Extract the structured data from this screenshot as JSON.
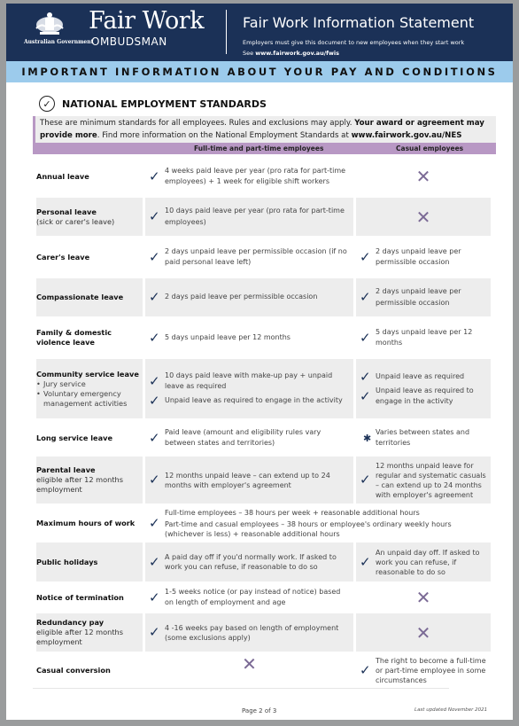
{
  "header": {
    "government": "Australian Government",
    "brand_line1": "Fair Work",
    "brand_line2": "OMBUDSMAN",
    "title": "Fair Work Information Statement",
    "subtitle": "Employers must give this document to new employees when they start work",
    "see_prefix": "See ",
    "see_link": "www.fairwork.gov.au/fwis"
  },
  "banner": "IMPORTANT INFORMATION ABOUT YOUR PAY AND CONDITIONS",
  "section": {
    "icon": "check-circle-icon",
    "title": "NATIONAL EMPLOYMENT STANDARDS",
    "intro_part1": "These are minimum standards for all employees. Rules and exclusions may apply. ",
    "intro_bold": "Your award or agreement may provide more",
    "intro_part2": ". Find more information on the National Employment Standards at ",
    "intro_link": "www.fairwork.gov.au/NES"
  },
  "columns": {
    "fulltime": "Full-time and part-time employees",
    "casual": "Casual employees"
  },
  "rows": [
    {
      "label": "Annual leave",
      "ft": "4 weeks paid leave per year (pro rata for part-time employees) + 1 week for eligible shift workers",
      "casual_mark": "cross"
    },
    {
      "label": "Personal leave",
      "sub": "(sick or carer's leave)",
      "ft": "10 days paid leave per year (pro rata for part-time employees)",
      "casual_mark": "cross"
    },
    {
      "label": "Carer's leave",
      "ft": "2 days unpaid leave per permissible occasion (if no paid personal leave left)",
      "casual": "2 days unpaid leave per permissible occasion"
    },
    {
      "label": "Compassionate leave",
      "ft": "2 days paid leave per permissible occasion",
      "casual": "2 days unpaid leave per permissible occasion"
    },
    {
      "label": "Family & domestic violence leave",
      "ft": "5 days unpaid leave per 12 months",
      "casual": "5 days unpaid leave per 12 months"
    },
    {
      "label": "Community service leave",
      "bullets": [
        "Jury service",
        "Voluntary emergency management activities"
      ],
      "ft_items": [
        "10 days paid leave with make-up pay + unpaid leave as required",
        "Unpaid leave as required to engage in the activity"
      ],
      "casual_items": [
        "Unpaid leave as required",
        "Unpaid leave as required to engage in the activity"
      ]
    },
    {
      "label": "Long service leave",
      "ft": "Paid leave (amount and eligibility rules vary between states and territories)",
      "casual": "Varies between states and territories",
      "casual_mark": "asterisk"
    },
    {
      "label": "Parental leave",
      "sub": "eligible after 12 months employment",
      "ft": "12 months unpaid leave – can extend up to 24 months with employer's agreement",
      "casual": "12 months unpaid leave for regular and systematic casuals – can extend up to 24 months with employer's agreement"
    },
    {
      "label": "Maximum hours of work",
      "span_line1": "Full-time employees – 38 hours per week + reasonable additional hours",
      "span_line2": "Part-time and casual employees – 38 hours or employee's ordinary weekly hours (whichever is less) + reasonable additional hours"
    },
    {
      "label": "Public holidays",
      "ft": "A paid day off if you'd normally work. If asked to work you can refuse, if reasonable to do so",
      "casual": "An unpaid day off. If asked to work you can refuse, if reasonable to do so"
    },
    {
      "label": "Notice of termination",
      "ft": "1-5 weeks notice (or pay instead of notice) based on length of employment and age",
      "casual_mark": "cross"
    },
    {
      "label": "Redundancy pay",
      "sub": "eligible after 12 months employment",
      "ft": "4 -16 weeks pay based on length of employment (some exclusions apply)",
      "casual_mark": "cross"
    },
    {
      "label": "Casual conversion",
      "ft_mark": "cross",
      "casual": "The right to become a full-time or part-time employee in some circumstances"
    }
  ],
  "marks": {
    "tick": "✓",
    "cross": "✕",
    "asterisk": "✱",
    "check_circle": "✓",
    "bullet": "•"
  },
  "footer": {
    "page": "Page 2 of 3",
    "updated": "Last updated November 2021"
  },
  "colors": {
    "navy": "#1b3157",
    "light_blue": "#9ccbec",
    "purple": "#b898c4",
    "cross": "#7b6a95",
    "shade": "#ededed"
  }
}
